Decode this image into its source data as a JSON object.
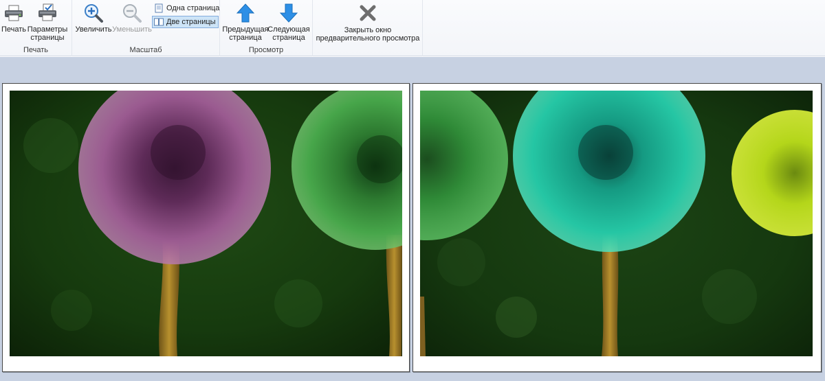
{
  "ribbon": {
    "print_group": {
      "label": "Печать",
      "print_button": "Печать",
      "page_setup_line1": "Параметры",
      "page_setup_line2": "страницы"
    },
    "zoom_group": {
      "label": "Масштаб",
      "zoom_in": "Увеличить",
      "zoom_out": "Уменьшить",
      "one_page": "Одна страница",
      "two_pages": "Две страницы",
      "selected_view": "two_pages"
    },
    "view_group": {
      "label": "Просмотр",
      "prev_line1": "Предыдущая",
      "prev_line2": "страница",
      "next_line1": "Следующая",
      "next_line2": "страница"
    },
    "close_group": {
      "close_line1": "Закрыть окно",
      "close_line2": "предварительного просмотра"
    }
  },
  "preview": {
    "pages": [
      {
        "image": "dandelions-photo-left",
        "flowers": [
          "purple",
          "green"
        ]
      },
      {
        "image": "dandelions-photo-right",
        "flowers": [
          "green",
          "teal",
          "yellow"
        ]
      }
    ]
  },
  "colors": {
    "workarea_background": "#c7d1e2",
    "selected_button": "#cde4f7",
    "arrow_blue": "#2d8fe6",
    "close_gray": "#6e6e6e"
  }
}
